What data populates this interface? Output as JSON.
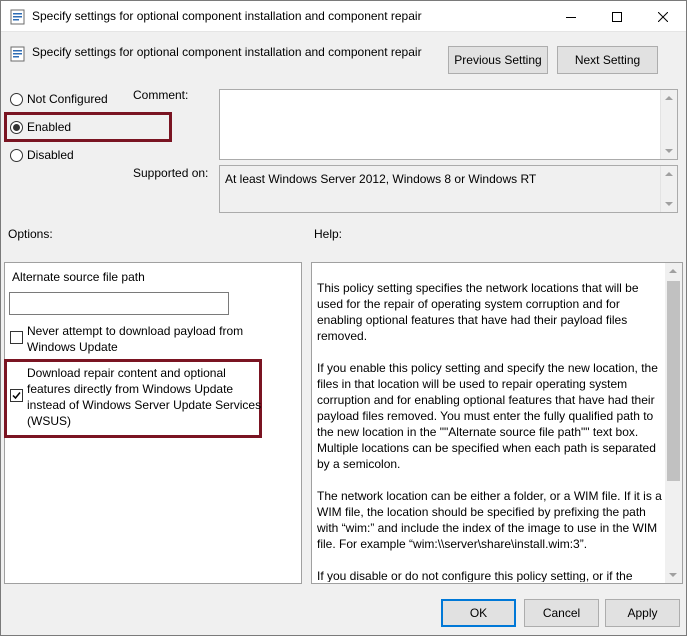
{
  "window": {
    "title": "Specify settings for optional component installation and component repair"
  },
  "header": {
    "setting_title": "Specify settings for optional component installation and component repair",
    "previous_label": "Previous Setting",
    "next_label": "Next Setting"
  },
  "state": {
    "options": [
      {
        "label": "Not Configured",
        "selected": false
      },
      {
        "label": "Enabled",
        "selected": true
      },
      {
        "label": "Disabled",
        "selected": false
      }
    ]
  },
  "comment": {
    "label": "Comment:",
    "value": ""
  },
  "supported": {
    "label": "Supported on:",
    "value": "At least Windows Server 2012, Windows 8 or Windows RT"
  },
  "options": {
    "label": "Options:",
    "alt_source_label": "Alternate source file path",
    "alt_source_value": "",
    "never_download_line1": "Never attempt to download payload from",
    "never_download_line2": "Windows Update",
    "never_download_checked": false,
    "wu_line1": "Download repair content and optional",
    "wu_line2": "features directly from Windows Update",
    "wu_line3": "instead of Windows Server Update Services",
    "wu_line4": "(WSUS)",
    "wu_checked": true
  },
  "help": {
    "label": "Help:",
    "paragraphs": [
      "This policy setting specifies the network locations that will be used for the repair of operating system corruption and for enabling optional features that have had their payload files removed.",
      "If you enable this policy setting and specify the new location, the files in that location will be used to repair operating system corruption and for enabling optional features that have had their payload files removed. You must enter the fully qualified path to the new location in the \"\"Alternate source file path\"\" text box. Multiple locations can be specified when each path is separated by a semicolon.",
      "The network location can be either a folder, or a WIM file. If it is a WIM file, the location should be specified by prefixing the path with “wim:” and include the index of the image to use in the WIM file. For example “wim:\\\\server\\share\\install.wim:3”.",
      "If you disable or do not configure this policy setting, or if the required files cannot be found at the locations specified in this"
    ]
  },
  "footer": {
    "ok_label": "OK",
    "cancel_label": "Cancel",
    "apply_label": "Apply"
  },
  "colors": {
    "highlight": "#7a1422",
    "focus": "#0078d7"
  }
}
